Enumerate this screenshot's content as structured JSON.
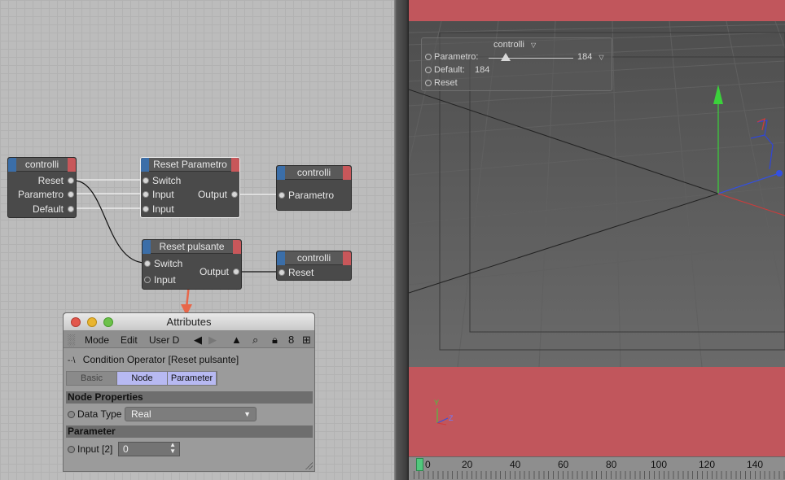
{
  "nodes": {
    "controlli_source": {
      "title": "controlli",
      "ports_out": [
        "Reset",
        "Parametro",
        "Default"
      ]
    },
    "reset_parametro": {
      "title": "Reset Parametro",
      "ports_in": [
        "Switch",
        "Input",
        "Input"
      ],
      "port_out": "Output"
    },
    "controlli_param": {
      "title": "controlli",
      "port_in": "Parametro"
    },
    "reset_pulsante": {
      "title": "Reset pulsante",
      "ports_in": [
        "Switch",
        "Input"
      ],
      "port_out": "Output"
    },
    "controlli_reset": {
      "title": "controlli",
      "port_in": "Reset"
    }
  },
  "attributes": {
    "window_title": "Attributes",
    "menu": [
      "Mode",
      "Edit",
      "User D"
    ],
    "toolbar_icons": [
      "back-arrow-icon",
      "forward-arrow-icon",
      "up-arrow-icon",
      "search-icon",
      "lock-icon",
      "link-icon",
      "new-panel-icon"
    ],
    "object_label": "Condition Operator [Reset pulsante]",
    "tabs": [
      {
        "label": "Basic",
        "active": false
      },
      {
        "label": "Node",
        "active": true
      },
      {
        "label": "Parameter",
        "active": true
      }
    ],
    "section_node": "Node Properties",
    "data_type_label": "Data Type",
    "data_type_value": "Real",
    "section_param": "Parameter",
    "input_label": "Input [2]",
    "input_value": "0"
  },
  "viewport": {
    "panel_title": "controlli",
    "parametro_label": "Parametro:",
    "parametro_value": "184",
    "default_label": "Default:",
    "default_value": "184",
    "reset_label": "Reset",
    "slider_fraction": 0.18,
    "axis_y": "Y",
    "axis_z": "Z"
  },
  "timeline": {
    "ticks": [
      "0",
      "20",
      "40",
      "60",
      "80",
      "100",
      "120",
      "140"
    ],
    "current_frame": 0
  },
  "colors": {
    "accent_blue": "#3b6ea8",
    "accent_red": "#c8575a",
    "tab_active": "#b7b9f2",
    "annotation_arrow": "#e8674a"
  }
}
